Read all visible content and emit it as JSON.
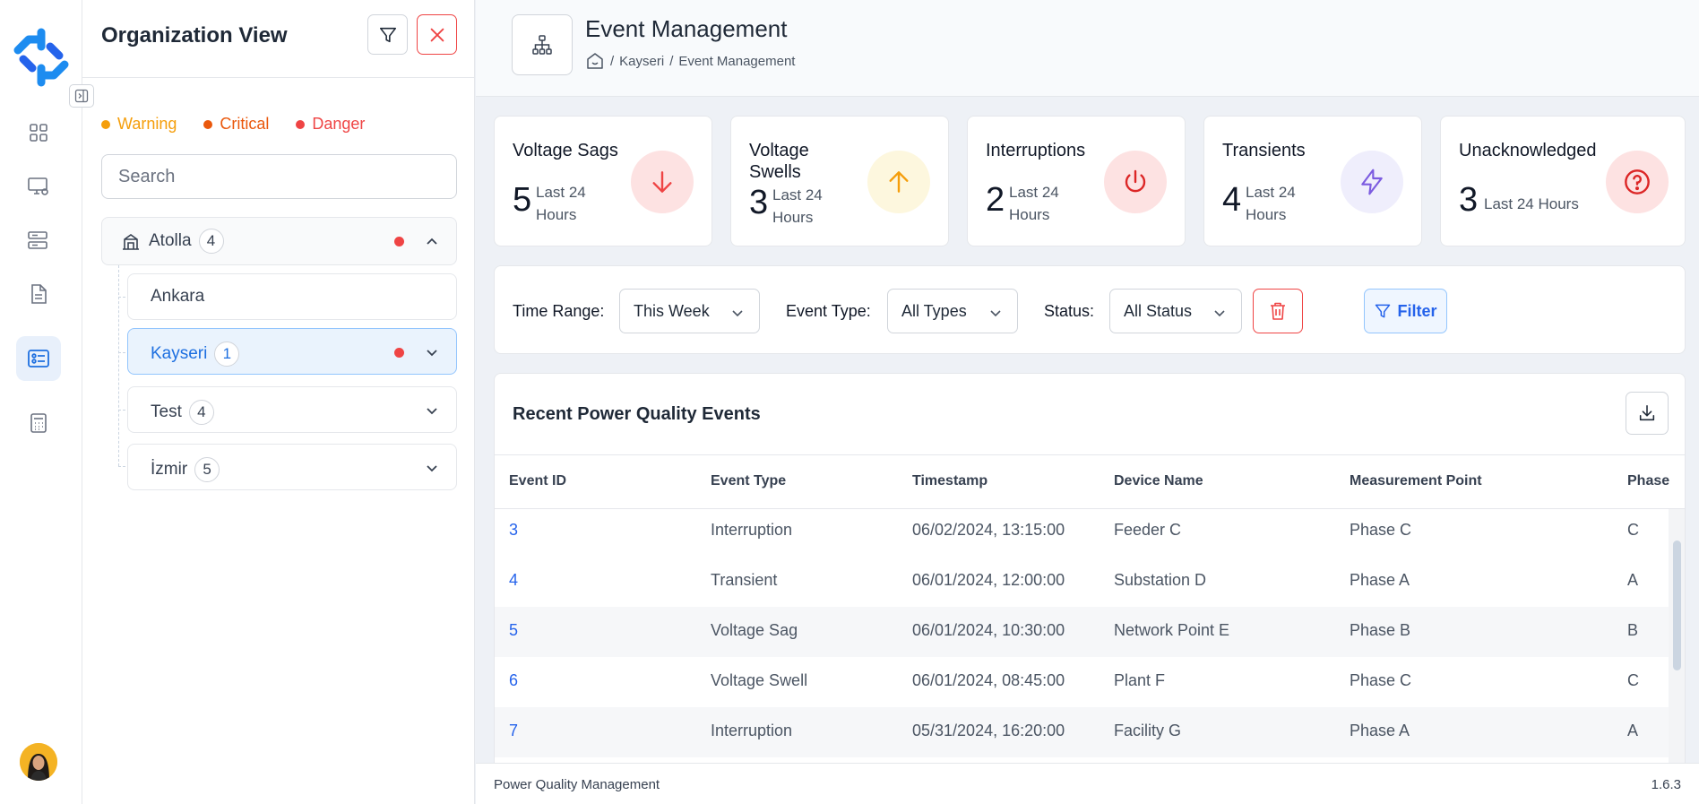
{
  "colors": {
    "warning": "#f59e0b",
    "critical": "#ea580c",
    "danger": "#ef4444",
    "accent": "#2563eb"
  },
  "org_panel": {
    "title": "Organization View",
    "legend": [
      {
        "label": "Warning",
        "color": "#f59e0b"
      },
      {
        "label": "Critical",
        "color": "#ea580c"
      },
      {
        "label": "Danger",
        "color": "#ef4444"
      }
    ],
    "search_placeholder": "Search",
    "root": {
      "label": "Atolla",
      "count": "4"
    },
    "nodes": [
      {
        "label": "Ankara",
        "count": ""
      },
      {
        "label": "Kayseri",
        "count": "1"
      },
      {
        "label": "Test",
        "count": "4"
      },
      {
        "label": "İzmir",
        "count": "5"
      }
    ]
  },
  "header": {
    "title": "Event Management",
    "breadcrumb": [
      "Kayseri",
      "Event Management"
    ],
    "breadcrumb_sep": "/"
  },
  "cards": [
    {
      "title": "Voltage Sags",
      "value": "5",
      "sub": "Last 24 Hours",
      "icon": "arrow-down-icon"
    },
    {
      "title": "Voltage Swells",
      "value": "3",
      "sub": "Last 24 Hours",
      "icon": "arrow-up-icon"
    },
    {
      "title": "Interruptions",
      "value": "2",
      "sub": "Last 24 Hours",
      "icon": "power-icon"
    },
    {
      "title": "Transients",
      "value": "4",
      "sub": "Last 24 Hours",
      "icon": "lightning-icon"
    },
    {
      "title": "Unacknowledged",
      "value": "3",
      "sub": "Last 24 Hours",
      "icon": "question-icon"
    }
  ],
  "filters": {
    "time_range_label": "Time Range:",
    "time_range_value": "This Week",
    "event_type_label": "Event Type:",
    "event_type_value": "All Types",
    "status_label": "Status:",
    "status_value": "All Status",
    "filter_button": "Filter"
  },
  "table": {
    "title": "Recent Power Quality Events",
    "columns": [
      "Event ID",
      "Event Type",
      "Timestamp",
      "Device Name",
      "Measurement Point",
      "Phase"
    ],
    "rows": [
      [
        "3",
        "Interruption",
        "06/02/2024, 13:15:00",
        "Feeder C",
        "Phase C",
        "C"
      ],
      [
        "4",
        "Transient",
        "06/01/2024, 12:00:00",
        "Substation D",
        "Phase A",
        "A"
      ],
      [
        "5",
        "Voltage Sag",
        "06/01/2024, 10:30:00",
        "Network Point E",
        "Phase B",
        "B"
      ],
      [
        "6",
        "Voltage Swell",
        "06/01/2024, 08:45:00",
        "Plant F",
        "Phase C",
        "C"
      ],
      [
        "7",
        "Interruption",
        "05/31/2024, 16:20:00",
        "Facility G",
        "Phase A",
        "A"
      ]
    ]
  },
  "footer": {
    "left": "Power Quality Management",
    "right": "1.6.3"
  }
}
